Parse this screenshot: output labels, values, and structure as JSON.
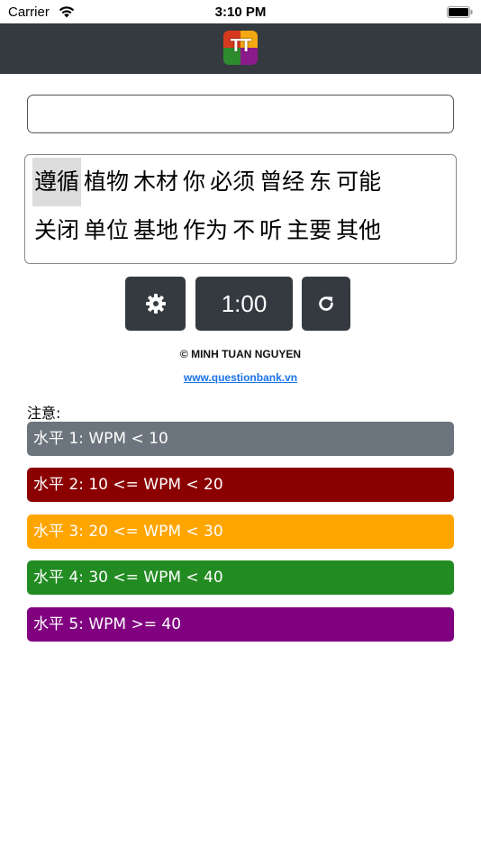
{
  "status_bar": {
    "carrier": "Carrier",
    "time": "3:10 PM"
  },
  "header": {
    "logo_text": "TT"
  },
  "typing": {
    "value": "",
    "placeholder": ""
  },
  "words": {
    "lines": [
      [
        "遵循",
        "植物",
        "木材",
        "你",
        "必须",
        "曾经",
        "东",
        "可能"
      ],
      [
        "关闭",
        "单位",
        "基地",
        "作为",
        "不",
        "听",
        "主要",
        "其他"
      ]
    ],
    "current_index": 0
  },
  "controls": {
    "timer": "1:00",
    "settings_icon": "gear-icon",
    "reset_icon": "refresh-icon"
  },
  "footer": {
    "copyright": "© MINH TUAN NGUYEN",
    "link": "www.questionbank.vn"
  },
  "notes": {
    "label": "注意:",
    "levels": [
      {
        "text": "水平 1: WPM < 10",
        "color": "#6c757d"
      },
      {
        "text": "水平 2: 10 <= WPM < 20",
        "color": "#8b0000"
      },
      {
        "text": "水平 3: 20 <= WPM < 30",
        "color": "#ffa500"
      },
      {
        "text": "水平 4: 30 <= WPM < 40",
        "color": "#228b22"
      },
      {
        "text": "水平 5: WPM >= 40",
        "color": "#800080"
      }
    ]
  }
}
